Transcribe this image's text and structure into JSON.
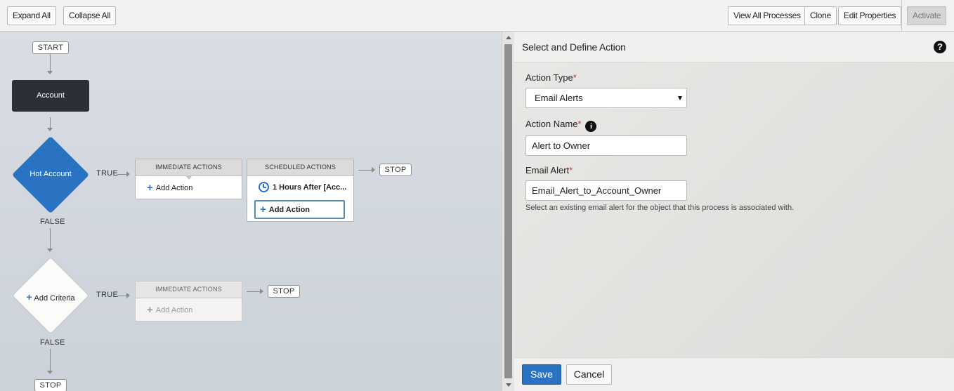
{
  "toolbar": {
    "expand_all": "Expand All",
    "collapse_all": "Collapse All",
    "view_all_processes": "View All Processes",
    "clone": "Clone",
    "edit_properties": "Edit Properties",
    "activate": "Activate"
  },
  "canvas": {
    "start": "START",
    "object_node": "Account",
    "criteria1": {
      "label": "Hot Account",
      "true_label": "TRUE",
      "false_label": "FALSE",
      "immediate_header": "IMMEDIATE ACTIONS",
      "immediate_add": "Add Action",
      "scheduled_header": "SCHEDULED ACTIONS",
      "scheduled_item": "1 Hours After [Acc...",
      "scheduled_add": "Add Action",
      "stop": "STOP"
    },
    "criteria2": {
      "label": "Add Criteria",
      "true_label": "TRUE",
      "false_label": "FALSE",
      "immediate_header": "IMMEDIATE ACTIONS",
      "immediate_add": "Add Action",
      "stop": "STOP"
    },
    "end_stop": "STOP"
  },
  "panel": {
    "title": "Select and Define Action",
    "help_icon": "?",
    "action_type_label": "Action Type",
    "action_type_value": "Email Alerts",
    "action_name_label": "Action Name",
    "info_icon": "i",
    "action_name_value": "Alert to Owner",
    "email_alert_label": "Email Alert",
    "email_alert_value": "Email_Alert_to_Account_Owner",
    "email_alert_hint": "Select an existing email alert for the object that this process is associated with.",
    "required_mark": "*",
    "save": "Save",
    "cancel": "Cancel"
  },
  "colors": {
    "accent": "#2a73c3",
    "object_node": "#2a2f38",
    "required": "#c23934"
  }
}
